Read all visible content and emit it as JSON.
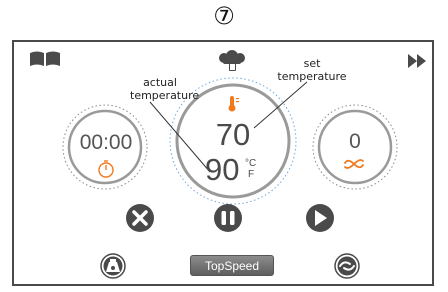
{
  "step_number": "⑦",
  "toolbar": {
    "left_icon": "recipe-book-icon",
    "center_icon": "chef-hat-icon",
    "right_icon": "fast-forward-icon"
  },
  "timer": {
    "value": "00:00",
    "icon": "stopwatch-icon"
  },
  "temperature": {
    "icon": "thermometer-icon",
    "set_value": "70",
    "actual_value": "90",
    "unit_c": "°C",
    "unit_f": "F"
  },
  "speed": {
    "value": "0",
    "icon": "fan-icon"
  },
  "controls": {
    "cancel_icon": "close-icon",
    "pause_icon": "pause-icon",
    "play_icon": "play-icon"
  },
  "bottom": {
    "scale_icon": "scale-icon",
    "topspeed_label": "TopSpeed",
    "turbo_icon": "turbo-icon"
  },
  "annotations": {
    "actual_line1": "actual",
    "actual_line2": "temperature",
    "set_line1": "set",
    "set_line2": "temperature"
  },
  "colors": {
    "accent_orange": "#f07a1e",
    "dark_icon": "#4a4a4a",
    "ring_blue": "#6fa8dc"
  }
}
